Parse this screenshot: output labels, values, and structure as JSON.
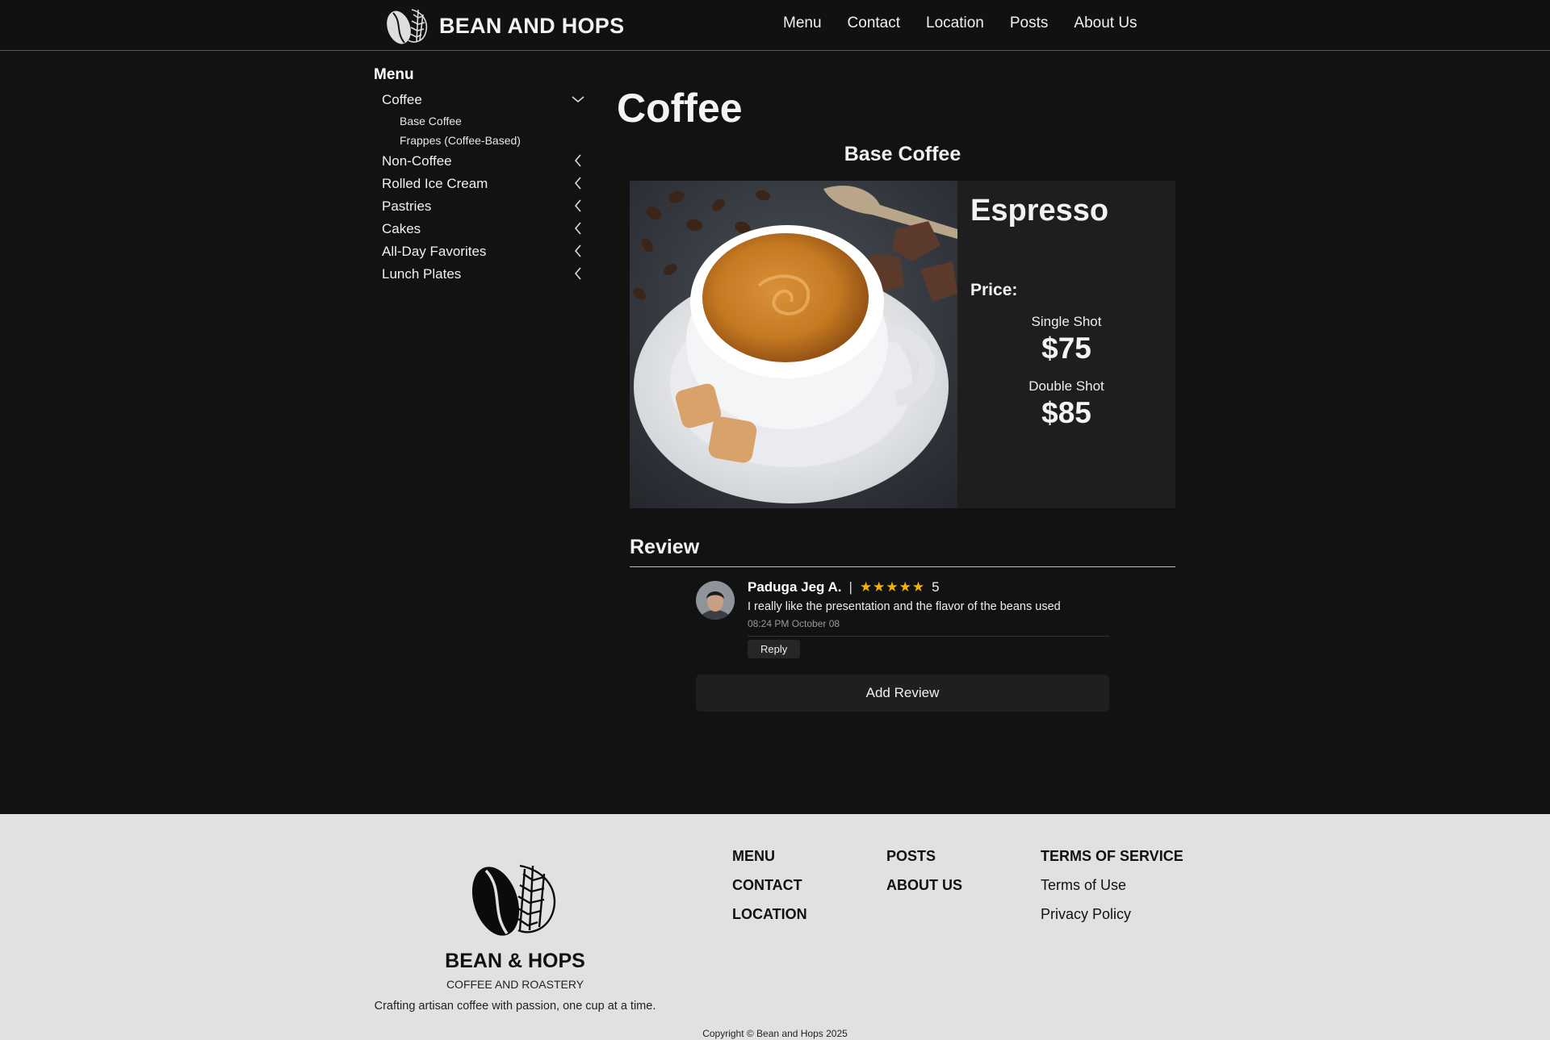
{
  "header": {
    "brand": "BEAN AND HOPS",
    "nav": [
      "Menu",
      "Contact",
      "Location",
      "Posts",
      "About Us"
    ]
  },
  "sidebar": {
    "title": "Menu",
    "categories": [
      {
        "label": "Coffee",
        "expanded": true,
        "children": [
          "Base Coffee",
          "Frappes (Coffee-Based)"
        ]
      },
      {
        "label": "Non-Coffee",
        "expanded": false
      },
      {
        "label": "Rolled Ice Cream",
        "expanded": false
      },
      {
        "label": "Pastries",
        "expanded": false
      },
      {
        "label": "Cakes",
        "expanded": false
      },
      {
        "label": "All-Day Favorites",
        "expanded": false
      },
      {
        "label": "Lunch Plates",
        "expanded": false
      }
    ]
  },
  "main": {
    "page_title": "Coffee",
    "section_title": "Base Coffee",
    "product": {
      "name": "Espresso",
      "price_label": "Price:",
      "options": [
        {
          "name": "Single Shot",
          "price": "$75"
        },
        {
          "name": "Double Shot",
          "price": "$85"
        }
      ]
    },
    "review_title": "Review",
    "review": {
      "name": "Paduga Jeg A.",
      "separator": "|",
      "stars": "★★★★★",
      "score": "5",
      "text": "I really like the presentation and the flavor of the beans used",
      "time": "08:24 PM October 08",
      "reply_label": "Reply"
    },
    "add_review_label": "Add Review"
  },
  "footer": {
    "brand": "BEAN & HOPS",
    "tagline": "COFFEE AND ROASTERY",
    "description": "Crafting artisan coffee with passion, one cup at a time.",
    "col1": [
      "MENU",
      "CONTACT",
      "LOCATION"
    ],
    "col2": [
      "POSTS",
      "ABOUT US"
    ],
    "col3_title": "TERMS OF SERVICE",
    "col3": [
      "Terms of Use",
      "Privacy Policy"
    ],
    "copyright": "Copyright © Bean and Hops 2025"
  },
  "colors": {
    "background": "#121212",
    "card": "#1e1e1e",
    "star": "#f5b301",
    "footer": "#e1e1e1"
  }
}
